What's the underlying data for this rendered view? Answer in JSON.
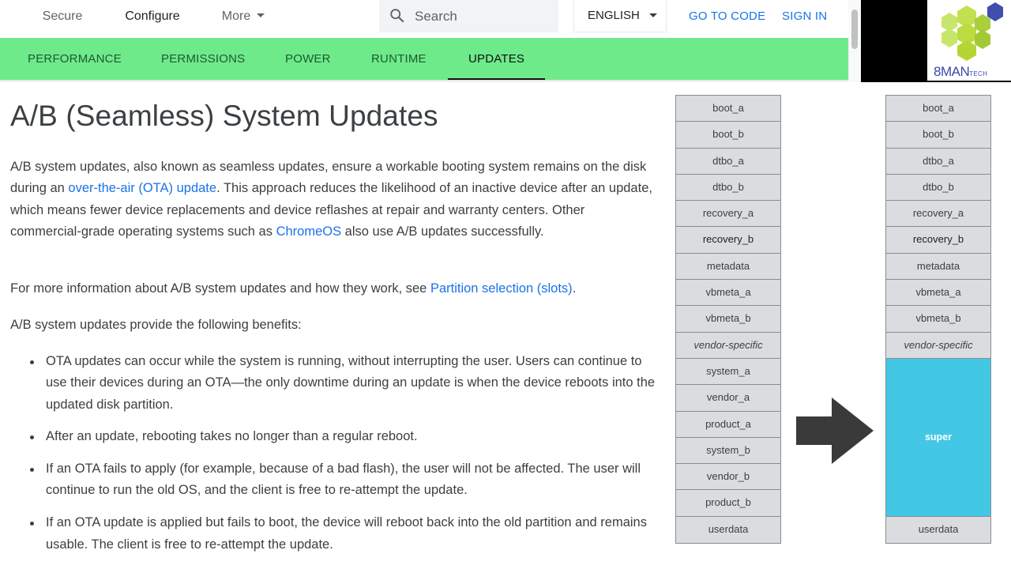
{
  "header": {
    "tabs": [
      {
        "label": "Secure",
        "active": false
      },
      {
        "label": "Configure",
        "active": true
      },
      {
        "label": "More",
        "active": false,
        "has_dropdown": true
      }
    ],
    "search": {
      "placeholder": "Search",
      "icon": "search-icon"
    },
    "language": {
      "selected": "ENGLISH",
      "icon": "caret-down-icon"
    },
    "links": {
      "go_to_code": "GO TO CODE",
      "sign_in": "SIGN IN"
    }
  },
  "logo": {
    "brand": "8MAN",
    "suffix": "TECH",
    "colors": {
      "hex_light": "#c6e56a",
      "hex_mid": "#b2d739",
      "hex_blue": "#3949ab"
    }
  },
  "subnav": {
    "tabs": [
      {
        "label": "PERFORMANCE",
        "active": false
      },
      {
        "label": "PERMISSIONS",
        "active": false
      },
      {
        "label": "POWER",
        "active": false
      },
      {
        "label": "RUNTIME",
        "active": false
      },
      {
        "label": "UPDATES",
        "active": true
      }
    ],
    "background": "#6eea8b"
  },
  "article": {
    "title": "A/B (Seamless) System Updates",
    "p1": {
      "t1": "A/B system updates, also known as seamless updates, ensure a workable booting system remains on the disk during an ",
      "link1": "over-the-air (OTA) update",
      "t2": ". This approach reduces the likelihood of an inactive device after an update, which means fewer device replacements and device reflashes at repair and warranty centers. Other commercial-grade operating systems such as ",
      "link2": "ChromeOS",
      "t3": " also use A/B updates successfully."
    },
    "p2": {
      "t1": "For more information about A/B system updates and how they work, see ",
      "link1": "Partition selection (slots)",
      "t2": "."
    },
    "p3": "A/B system updates provide the following benefits:",
    "bullets": [
      "OTA updates can occur while the system is running, without interrupting the user. Users can continue to use their devices during an OTA—the only downtime during an update is when the device reboots into the updated disk partition.",
      "After an update, rebooting takes no longer than a regular reboot.",
      "If an OTA fails to apply (for example, because of a bad flash), the user will not be affected. The user will continue to run the old OS, and the client is free to re-attempt the update.",
      "If an OTA update is applied but fails to boot, the device will reboot back into the old partition and remains usable. The client is free to re-attempt the update."
    ],
    "link_color": "#1a73e8"
  },
  "diagram": {
    "left_column": [
      "boot_a",
      "boot_b",
      "dtbo_a",
      "dtbo_b",
      "recovery_a",
      "recovery_b",
      "metadata",
      "vbmeta_a",
      "vbmeta_b",
      "vendor-specific",
      "system_a",
      "vendor_a",
      "product_a",
      "system_b",
      "vendor_b",
      "product_b",
      "userdata"
    ],
    "right_column": [
      "boot_a",
      "boot_b",
      "dtbo_a",
      "dtbo_b",
      "recovery_a",
      "recovery_b",
      "metadata",
      "vbmeta_a",
      "vbmeta_b",
      "vendor-specific",
      "super",
      "userdata"
    ],
    "arrow_icon": "right-arrow-icon",
    "super_color": "#42c7e4"
  }
}
